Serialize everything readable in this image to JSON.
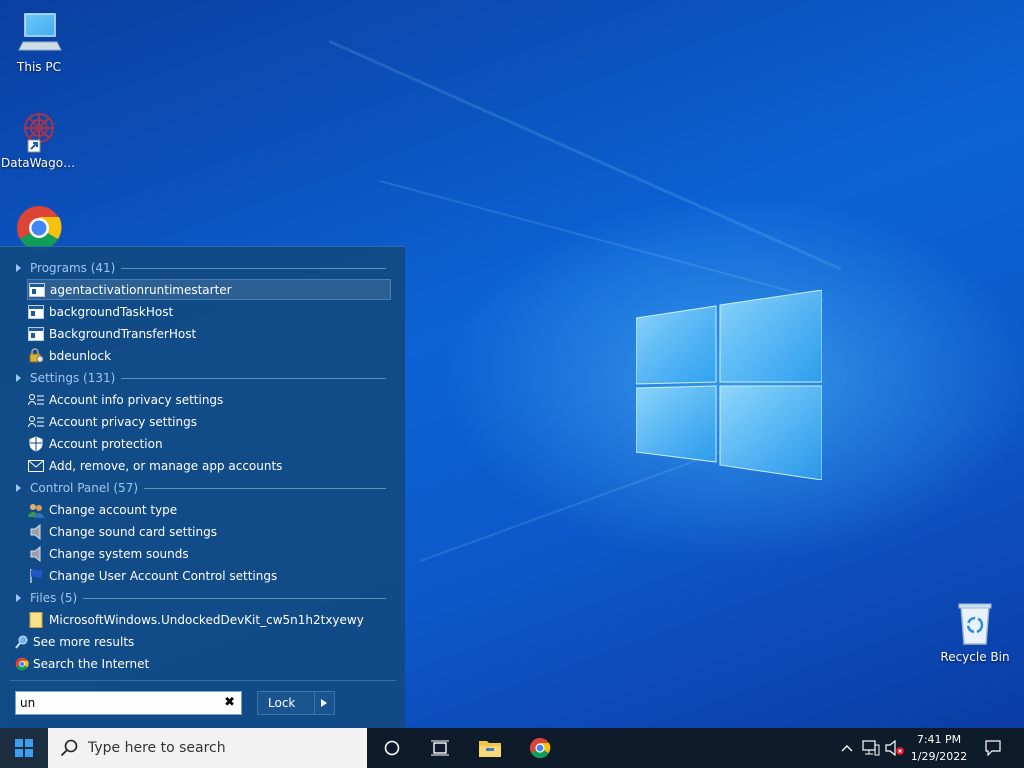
{
  "desktop": {
    "icons": [
      {
        "label": "This PC",
        "icon": "computer-icon"
      },
      {
        "label": "DataWagon...",
        "icon": "datawagon-shortcut-icon"
      },
      {
        "label": "",
        "icon": "chrome-icon"
      },
      {
        "label": "Recycle Bin",
        "icon": "recycle-bin-icon"
      }
    ]
  },
  "start_menu": {
    "groups": {
      "programs": "Programs (41)",
      "settings": "Settings (131)",
      "control_panel": "Control Panel (57)",
      "files": "Files (5)"
    },
    "programs": [
      {
        "label": "agentactivationruntimestarter",
        "icon": "app-window-icon",
        "selected": true
      },
      {
        "label": "backgroundTaskHost",
        "icon": "app-window-icon"
      },
      {
        "label": "BackgroundTransferHost",
        "icon": "app-window-icon"
      },
      {
        "label": "bdeunlock",
        "icon": "bitlocker-icon"
      }
    ],
    "settings": [
      {
        "label": "Account info privacy settings",
        "icon": "person-list-icon"
      },
      {
        "label": "Account privacy settings",
        "icon": "person-list-icon"
      },
      {
        "label": "Account protection",
        "icon": "shield-icon"
      },
      {
        "label": "Add, remove, or manage app accounts",
        "icon": "mail-icon"
      }
    ],
    "control_panel": [
      {
        "label": "Change account type",
        "icon": "users-icon"
      },
      {
        "label": "Change sound card settings",
        "icon": "speaker-icon"
      },
      {
        "label": "Change system sounds",
        "icon": "speaker-icon"
      },
      {
        "label": "Change User Account Control settings",
        "icon": "flag-icon"
      }
    ],
    "files": [
      {
        "label": "MicrosoftWindows.UndockedDevKit_cw5n1h2txyewy",
        "icon": "folder-icon"
      }
    ],
    "see_more": "See more results",
    "search_internet": "Search the Internet",
    "search_value": "un",
    "lock_label": "Lock"
  },
  "taskbar": {
    "search_placeholder": "Type here to search",
    "time": "7:41 PM",
    "date": "1/29/2022"
  },
  "colors": {
    "desktop_blue": "#0c63d6",
    "start_menu_bg": "#124a82",
    "taskbar_bg": "#0d1b2a",
    "group_header": "#9ec7ef"
  }
}
